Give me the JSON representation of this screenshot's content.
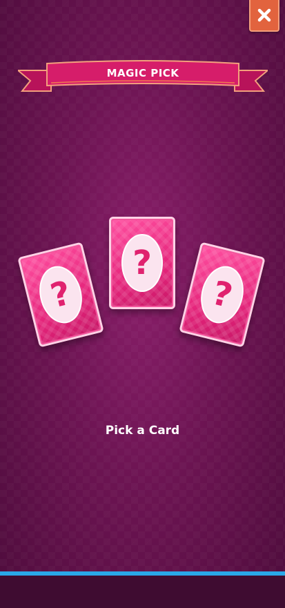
{
  "header": {
    "title": "MAGIC PICK",
    "close_icon": "close-icon"
  },
  "cards": [
    {
      "symbol": "?",
      "icon": "question-mark-icon"
    },
    {
      "symbol": "?",
      "icon": "question-mark-icon"
    },
    {
      "symbol": "?",
      "icon": "question-mark-icon"
    }
  ],
  "instruction": "Pick a Card",
  "progress": {
    "fraction": 1.0
  },
  "colors": {
    "background": "#6c1452",
    "card": "#e5257b",
    "banner": "#d61d6a",
    "close_button": "#e2633e",
    "progress": "#2aa8e8"
  }
}
